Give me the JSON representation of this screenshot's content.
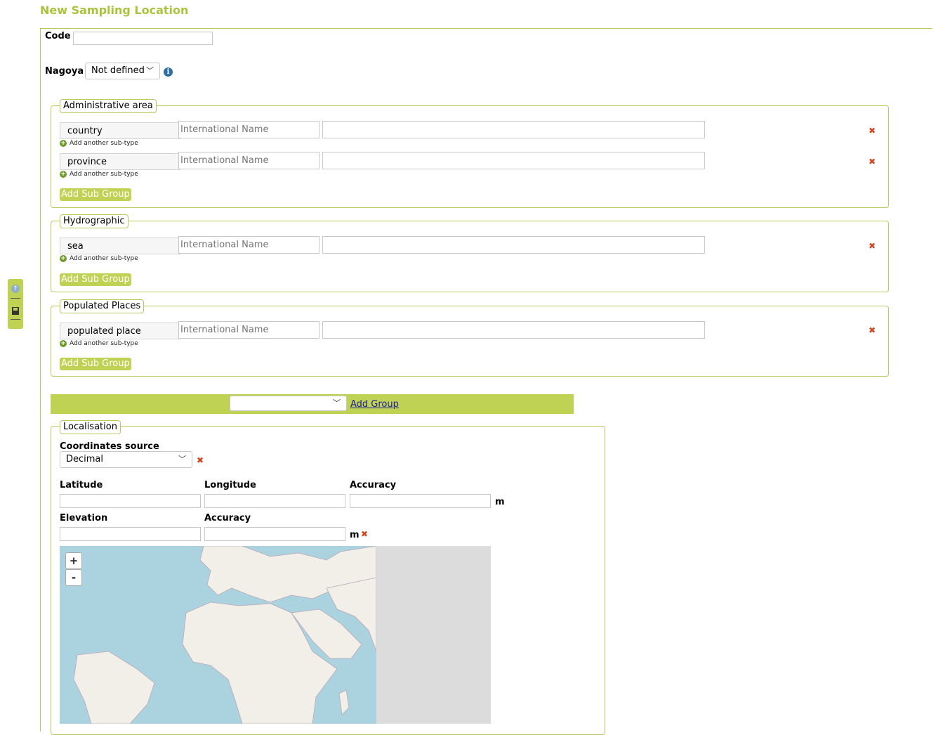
{
  "page": {
    "title": "New Sampling Location"
  },
  "code": {
    "label": "Code",
    "value": ""
  },
  "nagoya": {
    "label": "Nagoya",
    "selected": "Not defined",
    "info_icon": "info-icon"
  },
  "groups": [
    {
      "legend": "Administrative area",
      "rows": [
        {
          "subtype": "country",
          "name_placeholder": "International Name",
          "value": "",
          "add_label": "Add another sub-type"
        },
        {
          "subtype": "province",
          "name_placeholder": "International Name",
          "value": "",
          "add_label": "Add another sub-type"
        }
      ],
      "add_subgroup_label": "Add Sub Group"
    },
    {
      "legend": "Hydrographic",
      "rows": [
        {
          "subtype": "sea",
          "name_placeholder": "International Name",
          "value": "",
          "add_label": "Add another sub-type"
        }
      ],
      "add_subgroup_label": "Add Sub Group"
    },
    {
      "legend": "Populated Places",
      "rows": [
        {
          "subtype": "populated place",
          "name_placeholder": "International Name",
          "value": "",
          "add_label": "Add another sub-type"
        }
      ],
      "add_subgroup_label": "Add Sub Group"
    }
  ],
  "add_group": {
    "selected": "",
    "link_label": "Add Group"
  },
  "localisation": {
    "legend": "Localisation",
    "coord_source_label": "Coordinates source",
    "coord_source_value": "Decimal",
    "latitude_label": "Latitude",
    "longitude_label": "Longitude",
    "accuracy_label": "Accuracy",
    "accuracy_unit": "m",
    "elevation_label": "Elevation",
    "elevation_accuracy_label": "Accuracy",
    "elevation_unit": "m",
    "latitude_value": "",
    "longitude_value": "",
    "accuracy_value": "",
    "elevation_value": "",
    "elevation_accuracy_value": ""
  },
  "map": {
    "zoom_in": "+",
    "zoom_out": "-"
  },
  "icons": {
    "remove": "✖",
    "plus": "+",
    "chevron": "⌄"
  },
  "colors": {
    "accent": "#c0d253",
    "title": "#a9c33d",
    "remove": "#d2451e"
  }
}
